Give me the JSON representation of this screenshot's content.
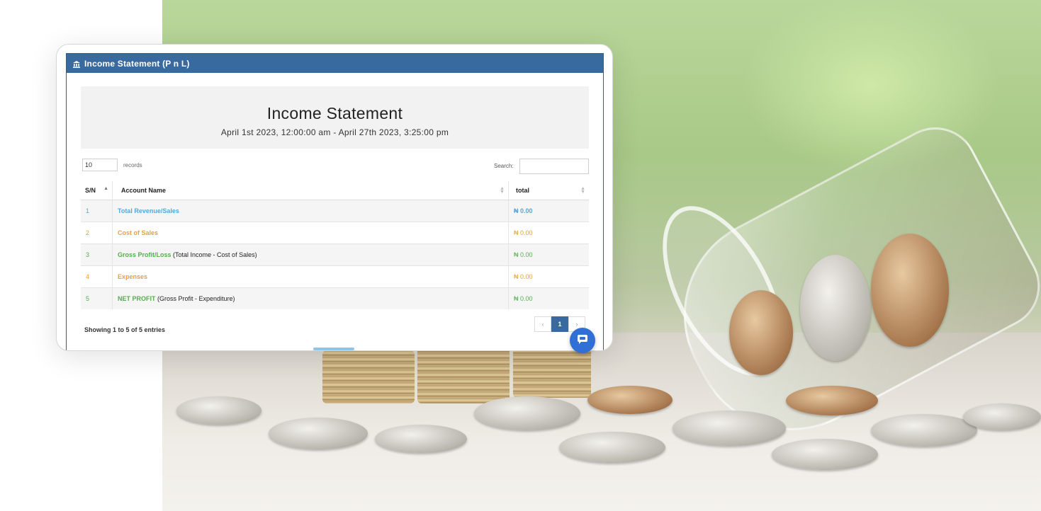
{
  "panel": {
    "title": "Income Statement (P n L)",
    "icon": "bank-icon"
  },
  "statement": {
    "title": "Income Statement",
    "range": "April 1st 2023, 12:00:00 am - April 27th 2023, 3:25:00 pm"
  },
  "controls": {
    "records_value": "10",
    "records_label": "records",
    "search_label": "Search:",
    "search_value": ""
  },
  "table": {
    "headers": [
      "S/N",
      "Account Name",
      "total"
    ],
    "rows": [
      {
        "sn": "1",
        "account": "Total Revenue/Sales",
        "note": "",
        "total": "₦ 0.00",
        "color": "#55a7d6"
      },
      {
        "sn": "2",
        "account": "Cost of Sales",
        "note": "",
        "total": "₦ 0.00",
        "color": "#e9a03b"
      },
      {
        "sn": "3",
        "account": "Gross Profit/Loss",
        "note": "(Total Income - Cost of Sales)",
        "total": "₦ 0.00",
        "color": "#57ad4e"
      },
      {
        "sn": "4",
        "account": "Expenses",
        "note": "",
        "total": "₦ 0.00",
        "color": "#e9a03b"
      },
      {
        "sn": "5",
        "account": "NET PROFIT",
        "note": "(Gross Profit - Expenditure)",
        "total": "₦ 0.00",
        "color": "#57ad4e"
      }
    ]
  },
  "footer": {
    "info": "Showing 1 to 5 of 5 entries",
    "prev": "‹",
    "page": "1",
    "next": "›"
  },
  "colors": {
    "header_bg": "#386a9f",
    "chat_button": "#2f6fd6"
  }
}
